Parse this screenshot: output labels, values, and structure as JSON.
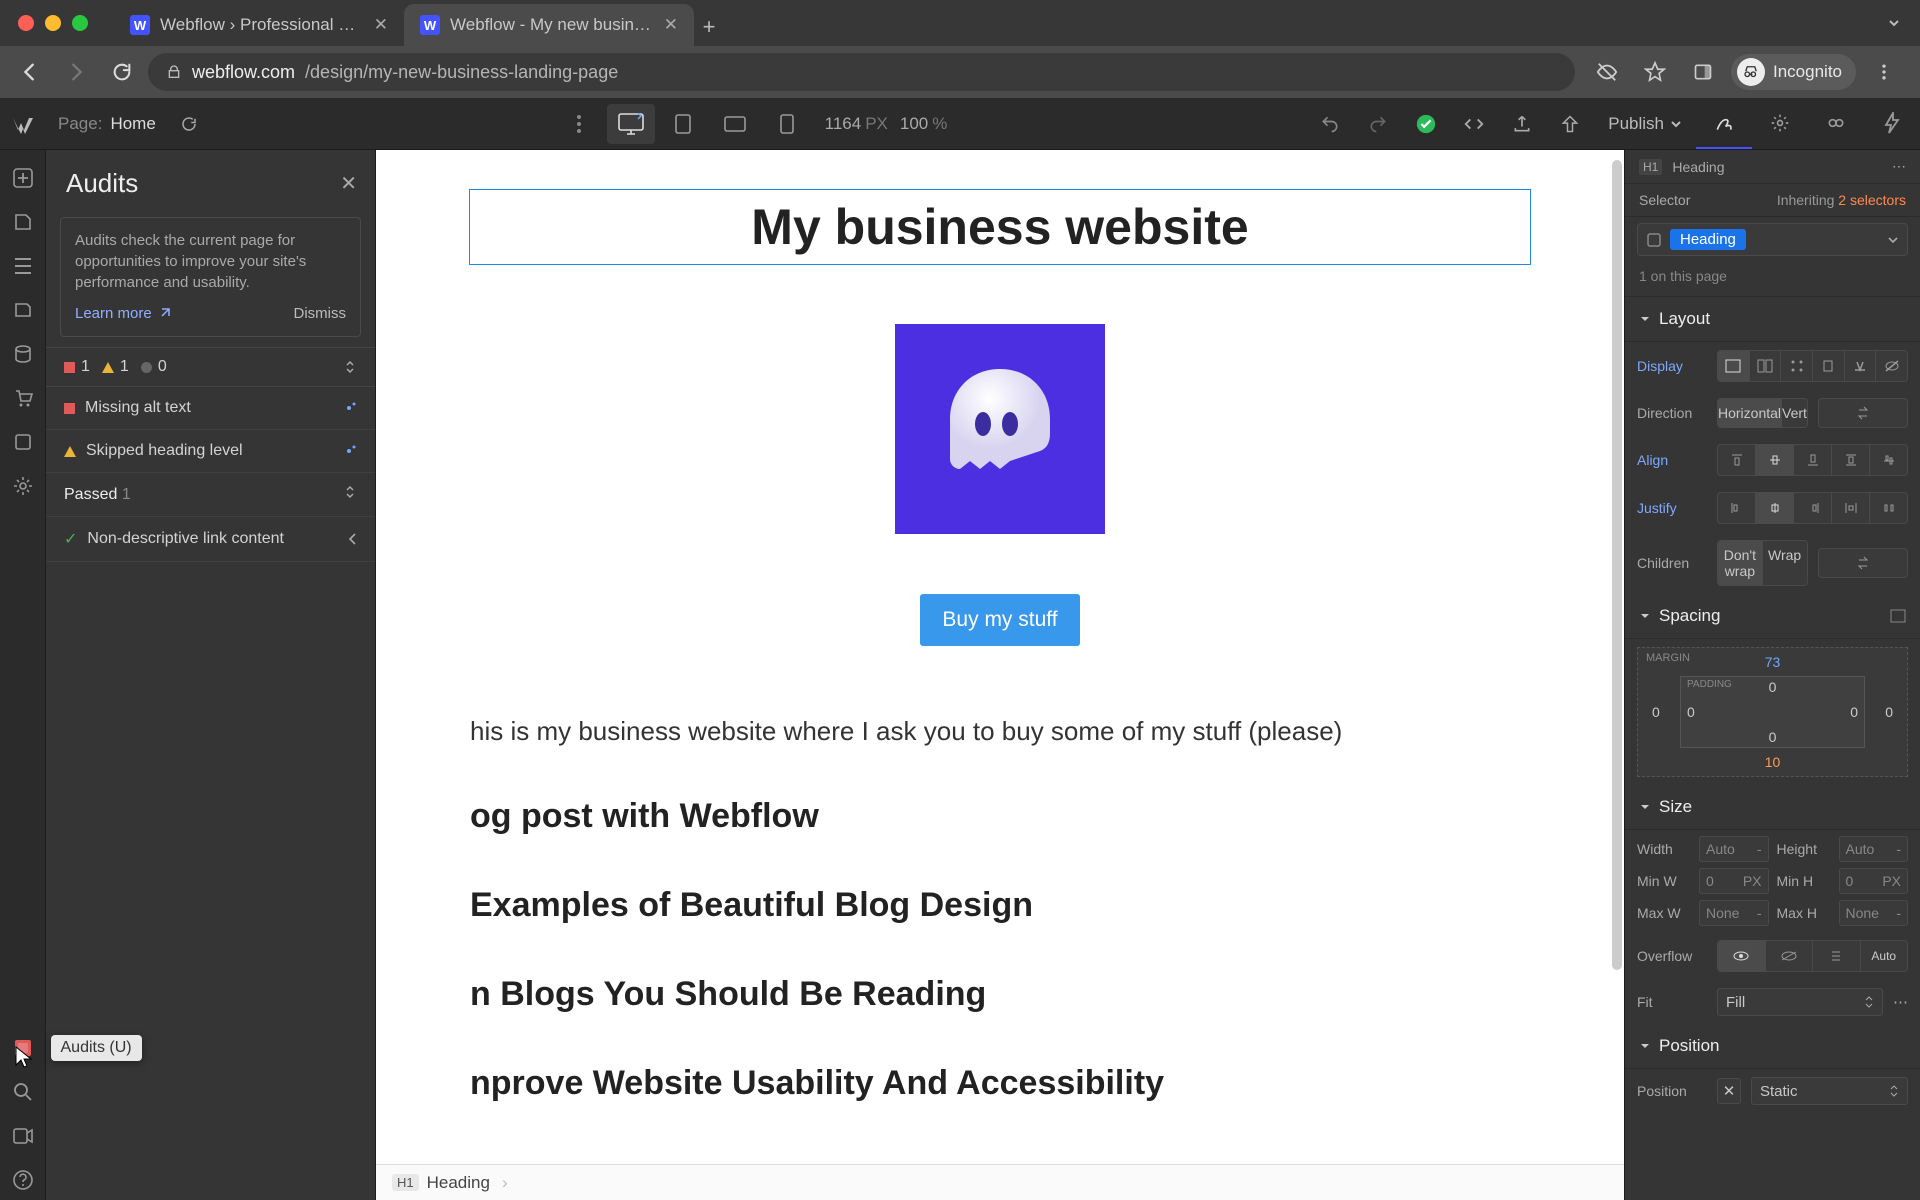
{
  "browser": {
    "tabs": [
      {
        "title": "Webflow › Professional Freelan"
      },
      {
        "title": "Webflow - My new business la"
      }
    ],
    "url_host": "webflow.com",
    "url_path": "/design/my-new-business-landing-page",
    "incognito_label": "Incognito"
  },
  "topbar": {
    "page_label": "Page:",
    "page_name": "Home",
    "canvas_width": "1164",
    "px": "PX",
    "zoom": "100",
    "zoom_unit": "%",
    "publish": "Publish"
  },
  "rail": {
    "tooltip": "Audits (U)"
  },
  "audits": {
    "title": "Audits",
    "info": "Audits check the current page for opportunities to improve your site's performance and usability.",
    "learn_more": "Learn more",
    "dismiss": "Dismiss",
    "count_error": "1",
    "count_warn": "1",
    "count_info": "0",
    "items": [
      {
        "level": "error",
        "label": "Missing alt text"
      },
      {
        "level": "warn",
        "label": "Skipped heading level"
      }
    ],
    "passed_label": "Passed",
    "passed_count": "1",
    "passed_items": [
      {
        "label": "Non-descriptive link content"
      }
    ]
  },
  "canvas": {
    "heading": "My business website",
    "cta": "Buy my stuff",
    "intro": "his is my business website where I ask you to buy some of my stuff (please)",
    "posts": [
      "og post with Webflow",
      "Examples of Beautiful Blog Design",
      "n Blogs You Should Be Reading",
      "nprove Website Usability And Accessibility"
    ],
    "crumb_tag": "H1",
    "crumb_label": "Heading"
  },
  "style": {
    "element_tag": "H1",
    "element_name": "Heading",
    "selector_label": "Selector",
    "inheriting_label": "Inheriting",
    "inheriting_count": "2 selectors",
    "selector_value": "Heading",
    "on_page": "1 on this page",
    "sections": {
      "layout": "Layout",
      "spacing": "Spacing",
      "size": "Size",
      "position": "Position"
    },
    "layout": {
      "display": "Display",
      "direction": "Direction",
      "dir_h": "Horizontal",
      "dir_v": "Vertical",
      "align": "Align",
      "justify": "Justify",
      "children": "Children",
      "wrap_no": "Don't wrap",
      "wrap_yes": "Wrap"
    },
    "spacing": {
      "margin_label": "MARGIN",
      "padding_label": "PADDING",
      "m_top": "73",
      "m_right": "0",
      "m_bottom": "10",
      "m_left": "0",
      "p_top": "0",
      "p_right": "0",
      "p_bottom": "0",
      "p_left": "0"
    },
    "size": {
      "width": "Width",
      "height": "Height",
      "minw": "Min W",
      "minh": "Min H",
      "maxw": "Max W",
      "maxh": "Max H",
      "auto": "Auto",
      "zero": "0",
      "px": "PX",
      "none": "None",
      "dash": "-",
      "overflow": "Overflow",
      "overflow_auto": "Auto",
      "fit": "Fit",
      "fit_val": "Fill"
    },
    "position": {
      "label": "Position",
      "value": "Static"
    }
  }
}
